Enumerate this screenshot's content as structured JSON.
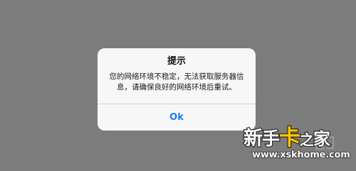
{
  "dialog": {
    "title": "提示",
    "message": "您的网络环境不稳定，无法获取服务器信息，请确保良好的网络环境后重试。",
    "ok_label": "Ok"
  },
  "watermark": {
    "chars": [
      "新",
      "手",
      "卡",
      "之",
      "家"
    ],
    "url": "www.xskhome.com"
  },
  "colors": {
    "background": "#7c7c7c",
    "dialog": "#f7f7f7",
    "link": "#1a7cf0",
    "watermark_accent": "#ffcc00"
  }
}
